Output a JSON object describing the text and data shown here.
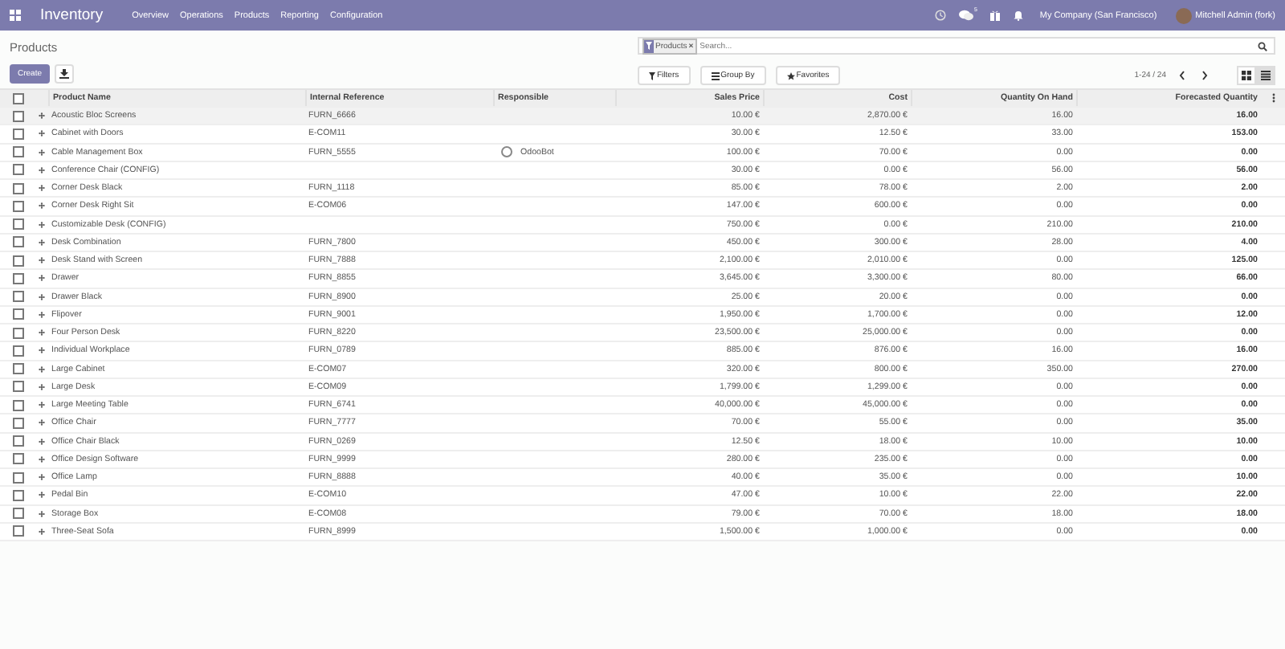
{
  "navbar": {
    "app_name": "Inventory",
    "menu": [
      "Overview",
      "Operations",
      "Products",
      "Reporting",
      "Configuration"
    ],
    "messages_badge": "5",
    "company": "My Company (San Francisco)",
    "user": "Mitchell Admin (fork)"
  },
  "control_panel": {
    "title": "Products",
    "create_button": "Create",
    "search": {
      "facet": "Products",
      "facet_remove": "×",
      "placeholder": "Search..."
    },
    "filters": "Filters",
    "group_by": "Group By",
    "favorites": "Favorites",
    "pager": "1-24 / 24",
    "views": [
      {
        "kind": "kanban",
        "selected": false
      },
      {
        "kind": "list",
        "selected": true
      }
    ]
  },
  "table": {
    "select_all_checked": false,
    "columns": [
      "Product Name",
      "Internal Reference",
      "Responsible",
      "Sales Price",
      "Cost",
      "Quantity On Hand",
      "Forecasted Quantity"
    ],
    "rows": [
      {
        "name": "Acoustic Bloc Screens",
        "ref": "FURN_6666",
        "responsible": "",
        "price": "10.00 €",
        "cost": "2,870.00 €",
        "on_hand": "16.00",
        "forecast": "16.00",
        "checked": false
      },
      {
        "name": "Cabinet with Doors",
        "ref": "E-COM11",
        "responsible": "",
        "price": "30.00 €",
        "cost": "12.50 €",
        "on_hand": "33.00",
        "forecast": "153.00",
        "checked": false
      },
      {
        "name": "Cable Management Box",
        "ref": "FURN_5555",
        "responsible": "OdooBot",
        "price": "100.00 €",
        "cost": "70.00 €",
        "on_hand": "0.00",
        "forecast": "0.00",
        "checked": false
      },
      {
        "name": "Conference Chair (CONFIG)",
        "ref": "",
        "responsible": "",
        "price": "30.00 €",
        "cost": "0.00 €",
        "on_hand": "56.00",
        "forecast": "56.00",
        "checked": false
      },
      {
        "name": "Corner Desk Black",
        "ref": "FURN_1118",
        "responsible": "",
        "price": "85.00 €",
        "cost": "78.00 €",
        "on_hand": "2.00",
        "forecast": "2.00",
        "checked": false
      },
      {
        "name": "Corner Desk Right Sit",
        "ref": "E-COM06",
        "responsible": "",
        "price": "147.00 €",
        "cost": "600.00 €",
        "on_hand": "0.00",
        "forecast": "0.00",
        "checked": false
      },
      {
        "name": "Customizable Desk (CONFIG)",
        "ref": "",
        "responsible": "",
        "price": "750.00 €",
        "cost": "0.00 €",
        "on_hand": "210.00",
        "forecast": "210.00",
        "checked": false
      },
      {
        "name": "Desk Combination",
        "ref": "FURN_7800",
        "responsible": "",
        "price": "450.00 €",
        "cost": "300.00 €",
        "on_hand": "28.00",
        "forecast": "4.00",
        "checked": false
      },
      {
        "name": "Desk Stand with Screen",
        "ref": "FURN_7888",
        "responsible": "",
        "price": "2,100.00 €",
        "cost": "2,010.00 €",
        "on_hand": "0.00",
        "forecast": "125.00",
        "checked": false
      },
      {
        "name": "Drawer",
        "ref": "FURN_8855",
        "responsible": "",
        "price": "3,645.00 €",
        "cost": "3,300.00 €",
        "on_hand": "80.00",
        "forecast": "66.00",
        "checked": false
      },
      {
        "name": "Drawer Black",
        "ref": "FURN_8900",
        "responsible": "",
        "price": "25.00 €",
        "cost": "20.00 €",
        "on_hand": "0.00",
        "forecast": "0.00",
        "checked": false
      },
      {
        "name": "Flipover",
        "ref": "FURN_9001",
        "responsible": "",
        "price": "1,950.00 €",
        "cost": "1,700.00 €",
        "on_hand": "0.00",
        "forecast": "12.00",
        "checked": false
      },
      {
        "name": "Four Person Desk",
        "ref": "FURN_8220",
        "responsible": "",
        "price": "23,500.00 €",
        "cost": "25,000.00 €",
        "on_hand": "0.00",
        "forecast": "0.00",
        "checked": false
      },
      {
        "name": "Individual Workplace",
        "ref": "FURN_0789",
        "responsible": "",
        "price": "885.00 €",
        "cost": "876.00 €",
        "on_hand": "16.00",
        "forecast": "16.00",
        "checked": false
      },
      {
        "name": "Large Cabinet",
        "ref": "E-COM07",
        "responsible": "",
        "price": "320.00 €",
        "cost": "800.00 €",
        "on_hand": "350.00",
        "forecast": "270.00",
        "checked": false
      },
      {
        "name": "Large Desk",
        "ref": "E-COM09",
        "responsible": "",
        "price": "1,799.00 €",
        "cost": "1,299.00 €",
        "on_hand": "0.00",
        "forecast": "0.00",
        "checked": false
      },
      {
        "name": "Large Meeting Table",
        "ref": "FURN_6741",
        "responsible": "",
        "price": "40,000.00 €",
        "cost": "45,000.00 €",
        "on_hand": "0.00",
        "forecast": "0.00",
        "checked": false
      },
      {
        "name": "Office Chair",
        "ref": "FURN_7777",
        "responsible": "",
        "price": "70.00 €",
        "cost": "55.00 €",
        "on_hand": "0.00",
        "forecast": "35.00",
        "checked": false
      },
      {
        "name": "Office Chair Black",
        "ref": "FURN_0269",
        "responsible": "",
        "price": "12.50 €",
        "cost": "18.00 €",
        "on_hand": "10.00",
        "forecast": "10.00",
        "checked": false
      },
      {
        "name": "Office Design Software",
        "ref": "FURN_9999",
        "responsible": "",
        "price": "280.00 €",
        "cost": "235.00 €",
        "on_hand": "0.00",
        "forecast": "0.00",
        "checked": false
      },
      {
        "name": "Office Lamp",
        "ref": "FURN_8888",
        "responsible": "",
        "price": "40.00 €",
        "cost": "35.00 €",
        "on_hand": "0.00",
        "forecast": "10.00",
        "checked": false
      },
      {
        "name": "Pedal Bin",
        "ref": "E-COM10",
        "responsible": "",
        "price": "47.00 €",
        "cost": "10.00 €",
        "on_hand": "22.00",
        "forecast": "22.00",
        "checked": false
      },
      {
        "name": "Storage Box",
        "ref": "E-COM08",
        "responsible": "",
        "price": "79.00 €",
        "cost": "70.00 €",
        "on_hand": "18.00",
        "forecast": "18.00",
        "checked": false
      },
      {
        "name": "Three-Seat Sofa",
        "ref": "FURN_8999",
        "responsible": "",
        "price": "1,500.00 €",
        "cost": "1,000.00 €",
        "on_hand": "0.00",
        "forecast": "0.00",
        "checked": false
      }
    ]
  }
}
